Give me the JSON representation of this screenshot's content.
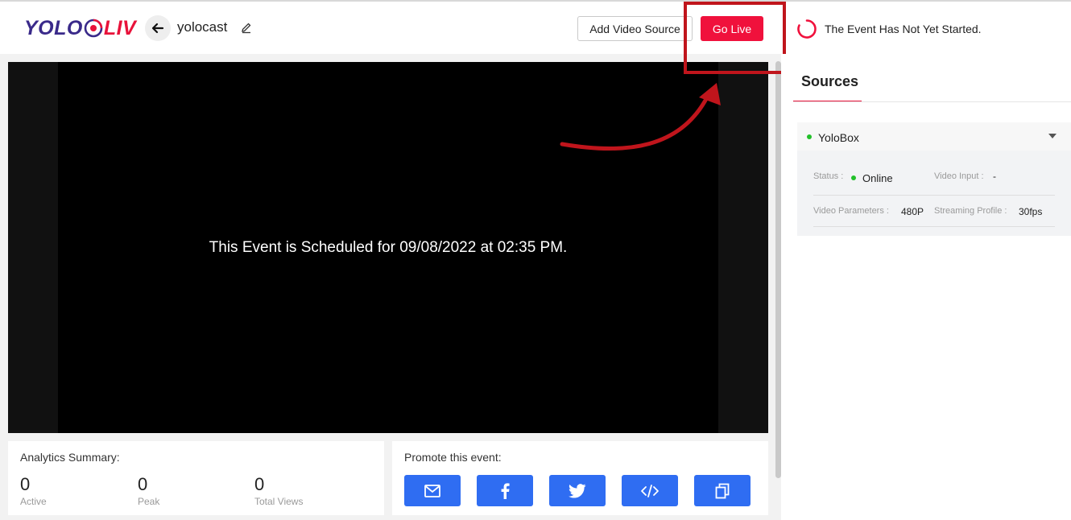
{
  "header": {
    "logo_left": "YOLO",
    "logo_right": "LIV",
    "event_name": "yolocast",
    "add_source_label": "Add Video Source",
    "go_live_label": "Go Live"
  },
  "status": {
    "text": "The Event Has Not Yet Started."
  },
  "player": {
    "message": "This Event is Scheduled for 09/08/2022 at 02:35 PM."
  },
  "analytics": {
    "title": "Analytics Summary:",
    "stats": [
      {
        "value": "0",
        "label": "Active"
      },
      {
        "value": "0",
        "label": "Peak"
      },
      {
        "value": "0",
        "label": "Total Views"
      }
    ]
  },
  "promote": {
    "title": "Promote this event:",
    "buttons": [
      "email-icon",
      "facebook-icon",
      "twitter-icon",
      "embed-code-icon",
      "copy-icon"
    ]
  },
  "sources": {
    "tab_label": "Sources",
    "items": [
      {
        "name": "YoloBox",
        "status_label": "Status :",
        "status_value": "Online",
        "video_input_label": "Video Input :",
        "video_input_value": "-",
        "video_params_label": "Video Parameters :",
        "video_params_value": "480P",
        "streaming_profile_label": "Streaming Profile :",
        "streaming_profile_value": "30fps"
      }
    ]
  },
  "colors": {
    "brand_red": "#f0113c",
    "brand_purple": "#3a2a8a",
    "share_blue": "#2f6df2",
    "online_green": "#22c02a",
    "annotation_red": "#c0151c"
  }
}
